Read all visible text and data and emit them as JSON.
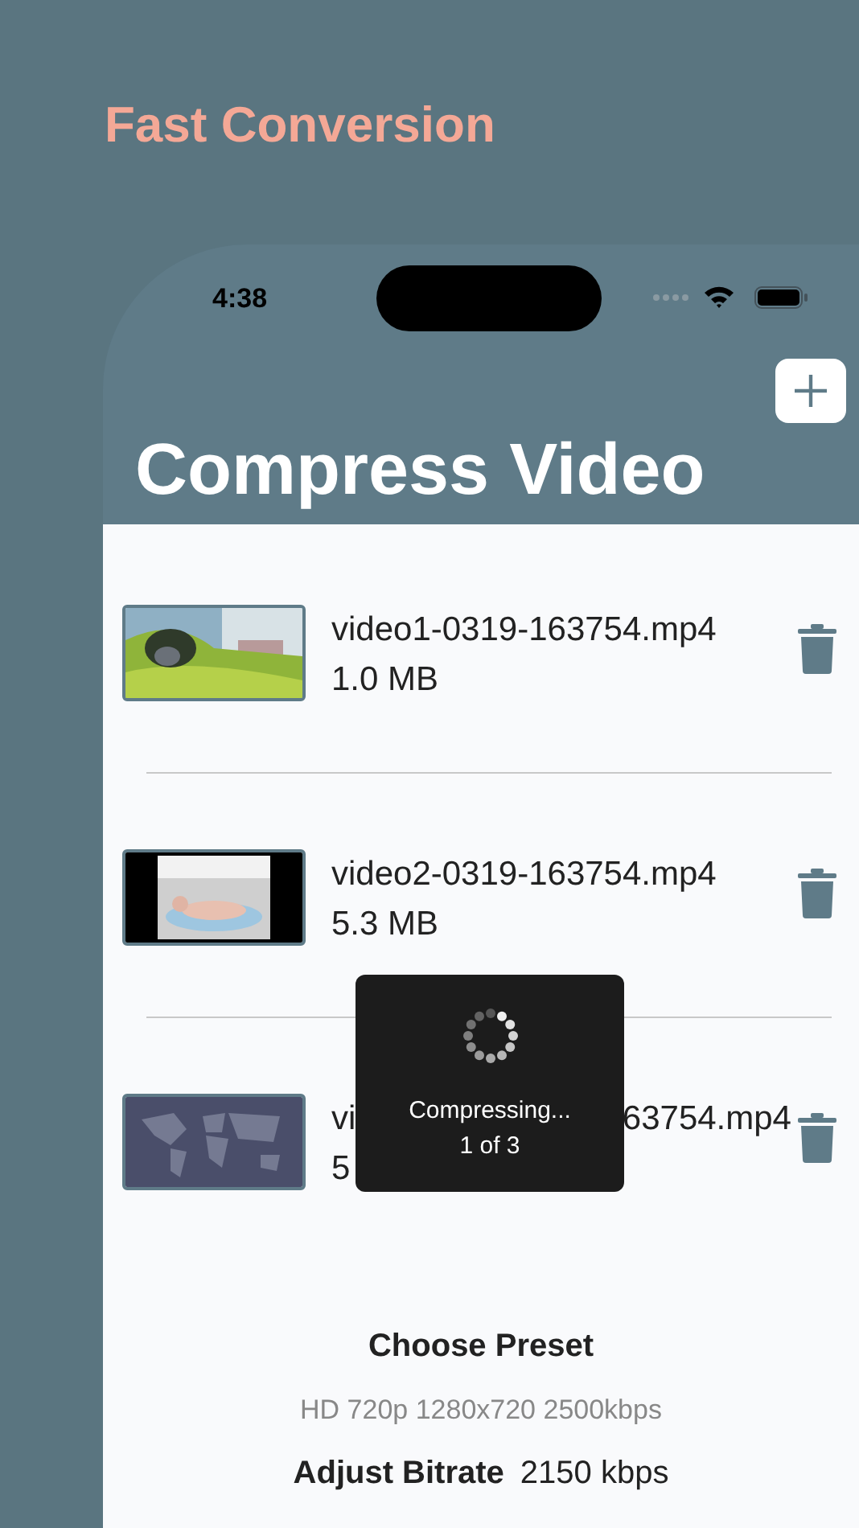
{
  "promo": {
    "headline": "Fast Conversion"
  },
  "status_bar": {
    "time": "4:38"
  },
  "header": {
    "title": "Compress Video"
  },
  "videos": [
    {
      "name": "video1-0319-163754.mp4",
      "size": "1.0 MB"
    },
    {
      "name": "video2-0319-163754.mp4",
      "size": "5.3 MB"
    },
    {
      "name": "vi",
      "name_tail": "63754.mp4",
      "size": "5"
    }
  ],
  "progress_hud": {
    "message": "Compressing...",
    "count": "1 of 3"
  },
  "settings": {
    "preset_heading": "Choose Preset",
    "preset": "HD 720p 1280x720 2500kbps",
    "bitrate_label": "Adjust Bitrate",
    "bitrate_value": "2150 kbps"
  }
}
